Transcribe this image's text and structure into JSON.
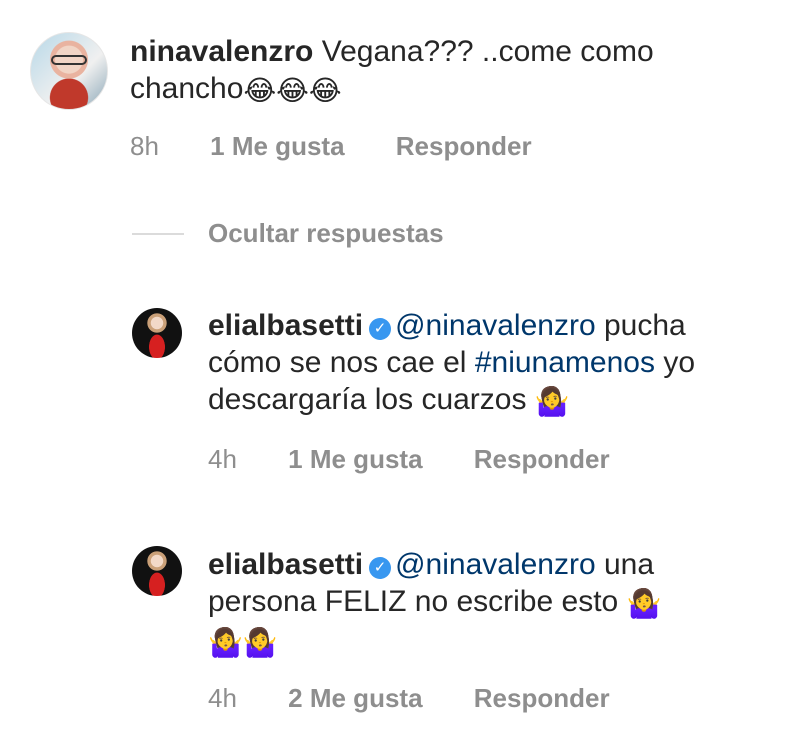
{
  "comments": [
    {
      "username": "ninavalenzro",
      "text_line1": "Vegana??? ..come como",
      "text_line2": "chancho",
      "emojis": "😂😂😂",
      "time": "8h",
      "likes": "1 Me gusta",
      "reply": "Responder"
    }
  ],
  "hide_replies": "Ocultar respuestas",
  "replies": [
    {
      "username": "elialbasetti",
      "verified_icon": "verified-badge",
      "mention": "@ninavalenzro",
      "text_line1": "pucha",
      "text_line2_a": "cómo se nos cae el",
      "hashtag": "#niunamenos",
      "text_line2_b": "yo",
      "text_line3": "descargaría los cuarzos",
      "emoji": "🤷‍♀️",
      "time": "4h",
      "likes": "1 Me gusta",
      "reply": "Responder"
    },
    {
      "username": "elialbasetti",
      "verified_icon": "verified-badge",
      "mention": "@ninavalenzro",
      "text_line1": "una",
      "text_line2": "persona FELIZ no escribe esto",
      "emoji_end": "🤷‍♀️",
      "emojis_line3": "🤷‍♀️🤷‍♀️",
      "time": "4h",
      "likes": "2 Me gusta",
      "reply": "Responder"
    }
  ]
}
